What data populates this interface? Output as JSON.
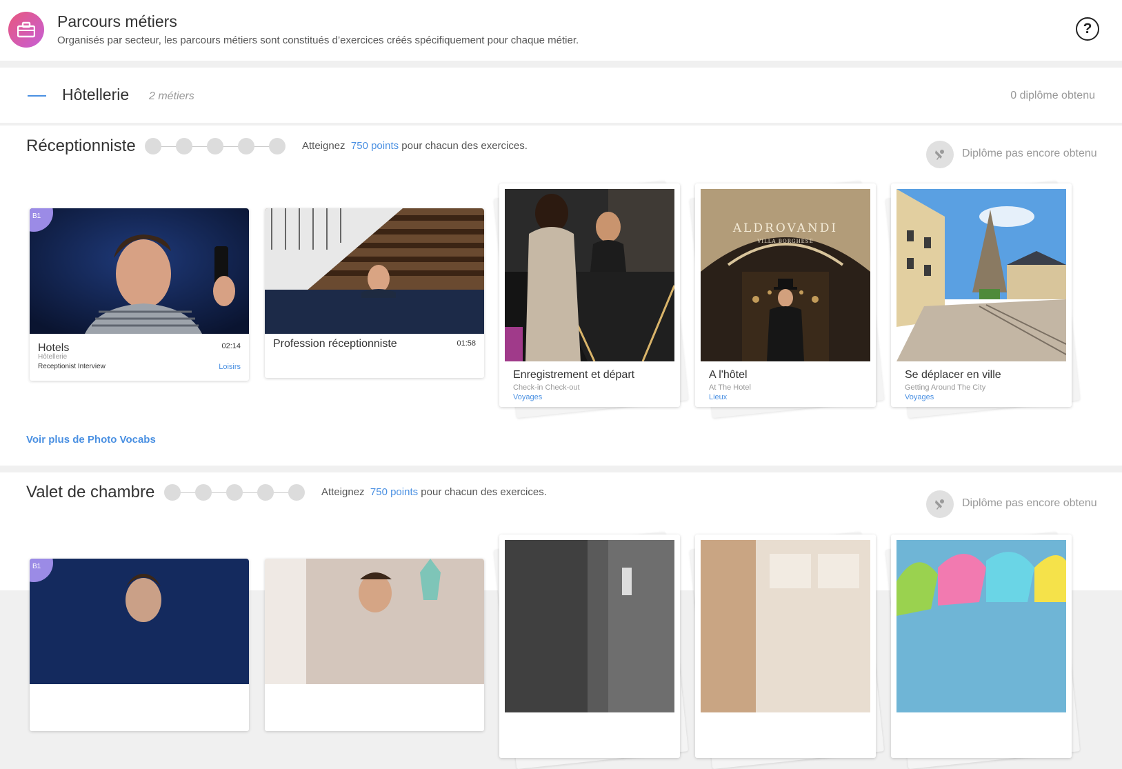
{
  "header": {
    "title": "Parcours métiers",
    "subtitle": "Organisés par secteur, les parcours métiers sont constitués d’exercices créés spécifiquement pour chaque métier.",
    "help_icon": "question-circle-icon",
    "help_text": "?"
  },
  "sector": {
    "name": "Hôtellerie",
    "count": "2 métiers",
    "diplomas": "0 diplôme obtenu"
  },
  "jobs": [
    {
      "title": "Réceptionniste",
      "reach_prefix": "Atteignez",
      "reach_points": "750 points",
      "reach_suffix": "pour chacun des exercices.",
      "diploma": "Diplôme pas encore obtenu",
      "videos": [
        {
          "level": "B1",
          "title": "Hotels",
          "duration": "02:14",
          "sector": "Hôtellerie",
          "interview": "Receptionist Interview",
          "category": "Loisirs"
        },
        {
          "title": "Profession réceptionniste",
          "duration": "01:58"
        }
      ],
      "photos": [
        {
          "title": "Enregistrement et départ",
          "subtitle": "Check-in Check-out",
          "category": "Voyages"
        },
        {
          "title": "A l'hôtel",
          "subtitle": "At The Hotel",
          "category": "Lieux",
          "sign": "ALDROVANDI",
          "sign_sub": "VILLA BORGHESE"
        },
        {
          "title": "Se déplacer en ville",
          "subtitle": "Getting Around The City",
          "category": "Voyages"
        }
      ],
      "more_link": "Voir plus de Photo Vocabs"
    },
    {
      "title": "Valet de chambre",
      "reach_prefix": "Atteignez",
      "reach_points": "750 points",
      "reach_suffix": "pour chacun des exercices.",
      "diploma": "Diplôme pas encore obtenu",
      "videos": [
        {
          "level": "B1"
        }
      ]
    }
  ],
  "colors": {
    "accent": "#4a90e2",
    "level_badge": "#9b8be6",
    "header_icon_from": "#e8577e",
    "header_icon_to": "#c65fd6"
  }
}
